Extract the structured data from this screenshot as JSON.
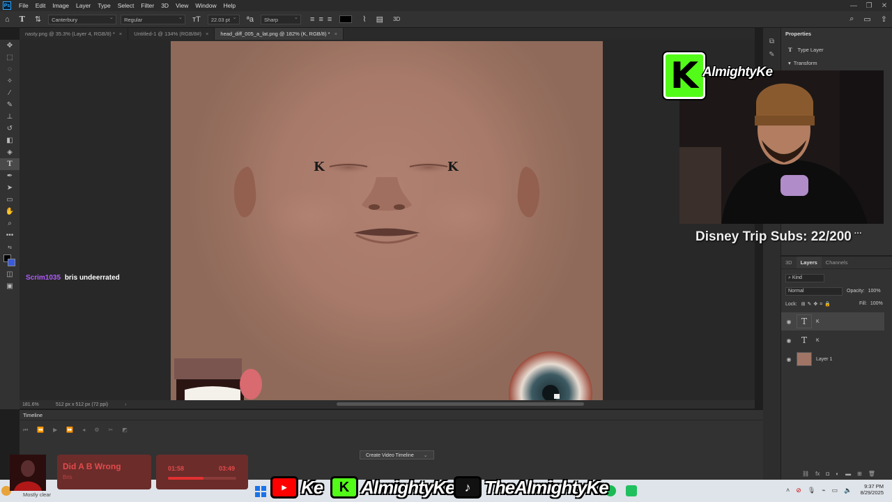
{
  "menubar": {
    "logo": "Ps",
    "items": [
      "File",
      "Edit",
      "Image",
      "Layer",
      "Type",
      "Select",
      "Filter",
      "3D",
      "View",
      "Window",
      "Help"
    ]
  },
  "options": {
    "font_family": "Canterbury",
    "font_style": "Regular",
    "font_size": "22.03 pt",
    "antialias": "Sharp",
    "three_d": "3D"
  },
  "tabs": [
    {
      "label": "nasty.png @ 35.3% (Layer 4, RGB/8) *",
      "active": false
    },
    {
      "label": "Untitled-1 @ 134% (RGB/8#)",
      "active": false
    },
    {
      "label": "head_diff_005_a_lat.png @ 182% (K, RGB/8) *",
      "active": true
    }
  ],
  "status": {
    "zoom": "181.6%",
    "dimensions": "512 px x 512 px (72 ppi)"
  },
  "timeline": {
    "title": "Timeline",
    "create_button": "Create Video Timeline"
  },
  "properties": {
    "title": "Properties",
    "type_layer": "Type Layer",
    "transform": "Transform"
  },
  "layers_panel": {
    "tabs": [
      "3D",
      "Layers",
      "Channels"
    ],
    "filter": "Kind",
    "blend_mode": "Normal",
    "opacity_label": "Opacity:",
    "opacity_value": "100%",
    "lock_label": "Lock:",
    "fill_label": "Fill:",
    "fill_value": "100%",
    "layers": [
      {
        "name": "K",
        "kind": "type",
        "active": true
      },
      {
        "name": "K",
        "kind": "type",
        "active": false
      },
      {
        "name": "Layer 1",
        "kind": "image",
        "active": false
      }
    ]
  },
  "stream": {
    "kick_letter": "K",
    "kick_name": "AlmightyKe",
    "subs_goal": "Disney Trip Subs: 22/200",
    "chat_user": "Scrim1035",
    "chat_message": "bris undeerrated",
    "chat_user_color": "#b05cff"
  },
  "music": {
    "title": "Did A B Wrong",
    "artist": "Bris",
    "elapsed": "01:58",
    "total": "03:49",
    "progress": 0.52
  },
  "taskbar": {
    "weather": "Mostly clear",
    "socials": [
      {
        "platform": "youtube-icon",
        "handle": "Ke"
      },
      {
        "platform": "kick-icon",
        "handle": "AlmightyKe"
      },
      {
        "platform": "tiktok-icon",
        "handle": "TheAlmightyKe"
      }
    ],
    "time": "9:37 PM",
    "date": "8/29/2025"
  }
}
